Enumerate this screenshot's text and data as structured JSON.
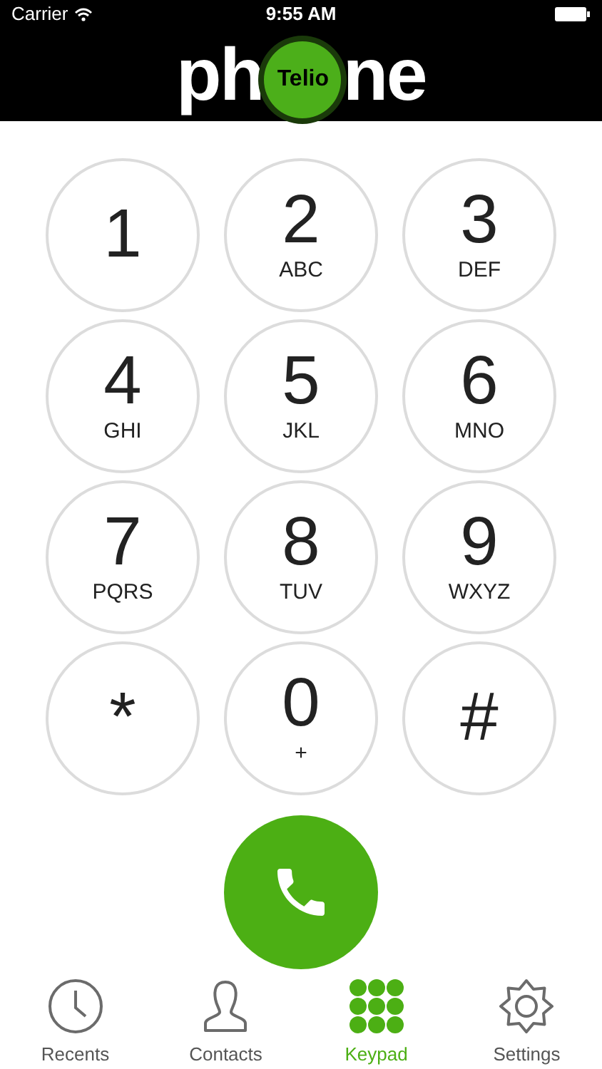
{
  "status_bar": {
    "carrier": "Carrier",
    "time": "9:55 AM"
  },
  "logo": {
    "left": "ph",
    "badge": "Telio",
    "right": "ne"
  },
  "keys": [
    {
      "digit": "1"
    },
    {
      "digit": "2",
      "letters": "ABC"
    },
    {
      "digit": "3",
      "letters": "DEF"
    },
    {
      "digit": "4",
      "letters": "GHI"
    },
    {
      "digit": "5",
      "letters": "JKL"
    },
    {
      "digit": "6",
      "letters": "MNO"
    },
    {
      "digit": "7",
      "letters": "PQRS"
    },
    {
      "digit": "8",
      "letters": "TUV"
    },
    {
      "digit": "9",
      "letters": "WXYZ"
    },
    {
      "digit": "*"
    },
    {
      "digit": "0",
      "letters": "+"
    },
    {
      "digit": "#"
    }
  ],
  "tabs": [
    {
      "label": "Recents",
      "kind": "clock",
      "selected": false
    },
    {
      "label": "Contacts",
      "kind": "person",
      "selected": false
    },
    {
      "label": "Keypad",
      "kind": "keypad",
      "selected": true
    },
    {
      "label": "Settings",
      "kind": "gear",
      "selected": false
    }
  ]
}
